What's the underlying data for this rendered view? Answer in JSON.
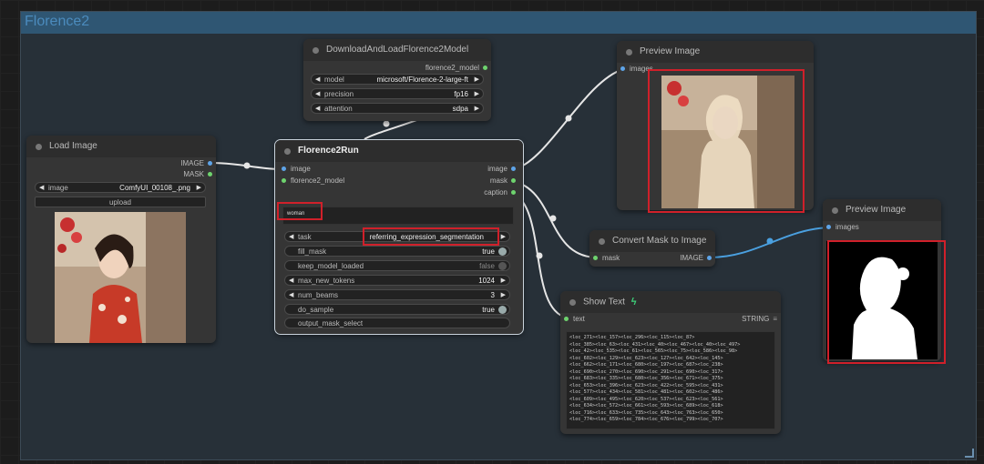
{
  "group": {
    "title": "Florence2"
  },
  "colors": {
    "group_header": "#2f5673",
    "link_white": "#e6e6e6",
    "link_blue": "#4aa0e0",
    "highlight": "#d0202a"
  },
  "download_node": {
    "title": "DownloadAndLoadFlorence2Model",
    "output": "florence2_model",
    "widgets": [
      {
        "label": "model",
        "value": "microsoft/Florence-2-large-ft"
      },
      {
        "label": "precision",
        "value": "fp16"
      },
      {
        "label": "attention",
        "value": "sdpa"
      }
    ]
  },
  "load_image": {
    "title": "Load Image",
    "outputs": [
      "IMAGE",
      "MASK"
    ],
    "image_widget": {
      "label": "image",
      "value": "ComfyUI_00108_.png"
    },
    "upload_label": "upload"
  },
  "florence_run": {
    "title": "Florence2Run",
    "inputs": [
      "image",
      "florence2_model"
    ],
    "outputs": [
      "image",
      "mask",
      "caption"
    ],
    "prompt_text": "woman",
    "widgets": [
      {
        "label": "task",
        "value": "referring_expression_segmentation"
      },
      {
        "label": "fill_mask",
        "value": "true"
      },
      {
        "label": "keep_model_loaded",
        "value": "false"
      },
      {
        "label": "max_new_tokens",
        "value": "1024"
      },
      {
        "label": "num_beams",
        "value": "3"
      },
      {
        "label": "do_sample",
        "value": "true"
      },
      {
        "label": "output_mask_select",
        "value": ""
      }
    ]
  },
  "preview1": {
    "title": "Preview Image",
    "input": "images"
  },
  "preview2": {
    "title": "Preview Image",
    "input": "images"
  },
  "convert_mask": {
    "title": "Convert Mask to Image",
    "input": "mask",
    "output": "IMAGE"
  },
  "show_text": {
    "title": "Show Text",
    "title_icon": "python-snake-icon",
    "input": "text",
    "output": "STRING",
    "menu_icon": "list-menu-icon",
    "content": "<loc_271><loc_157><loc_296><loc_115><loc_87>\n<loc_385><loc_63><loc_431><loc_40><loc_467><loc_40><loc_497>\n<loc_42><loc_535><loc_61><loc_565><loc_75><loc_586><loc_98>\n<loc_602><loc_129><loc_623><loc_127><loc_642><loc_145>\n<loc_662><loc_171><loc_680><loc_197><loc_687><loc_238>\n<loc_690><loc_270><loc_690><loc_291><loc_690><loc_317>\n<loc_683><loc_335><loc_680><loc_356><loc_671><loc_375>\n<loc_653><loc_396><loc_623><loc_422><loc_595><loc_431>\n<loc_577><loc_434><loc_581><loc_481><loc_602><loc_486>\n<loc_609><loc_495><loc_620><loc_537><loc_623><loc_561>\n<loc_634><loc_572><loc_661><loc_593><loc_689><loc_618>\n<loc_716><loc_633><loc_735><loc_643><loc_763><loc_650>\n<loc_774><loc_659><loc_784><loc_676><loc_799><loc_707>"
  }
}
